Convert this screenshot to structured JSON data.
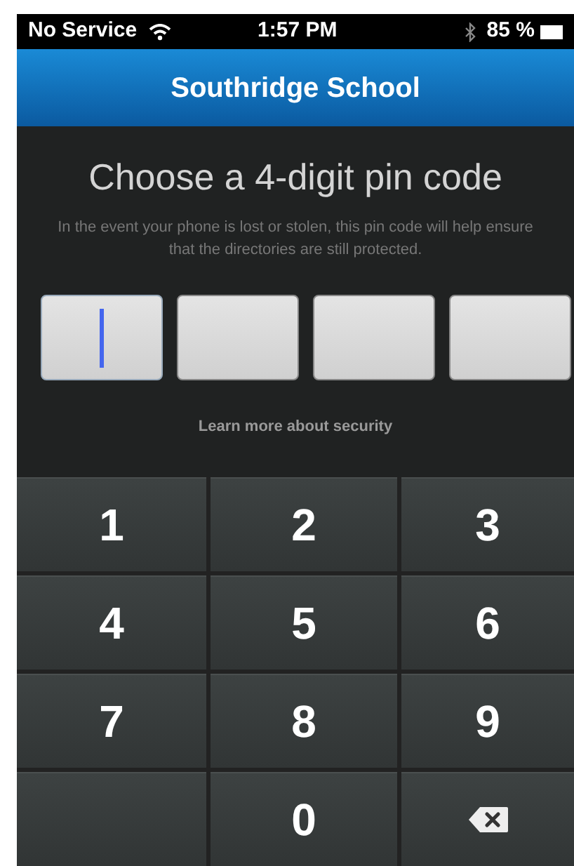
{
  "status_bar": {
    "carrier": "No Service",
    "time": "1:57 PM",
    "battery": "85 %"
  },
  "header": {
    "title": "Southridge School"
  },
  "heading": "Choose a 4-digit pin code",
  "description": "In the event your phone is lost or stolen, this pin code will help ensure that the directories are still protected.",
  "pin_boxes": [
    {
      "focused": true
    },
    {
      "focused": false
    },
    {
      "focused": false
    },
    {
      "focused": false
    }
  ],
  "link": "Learn more about security",
  "keypad": [
    {
      "kind": "digit",
      "label": "1"
    },
    {
      "kind": "digit",
      "label": "2"
    },
    {
      "kind": "digit",
      "label": "3"
    },
    {
      "kind": "digit",
      "label": "4"
    },
    {
      "kind": "digit",
      "label": "5"
    },
    {
      "kind": "digit",
      "label": "6"
    },
    {
      "kind": "digit",
      "label": "7"
    },
    {
      "kind": "digit",
      "label": "8"
    },
    {
      "kind": "digit",
      "label": "9"
    },
    {
      "kind": "blank"
    },
    {
      "kind": "digit",
      "label": "0"
    },
    {
      "kind": "backspace"
    }
  ]
}
